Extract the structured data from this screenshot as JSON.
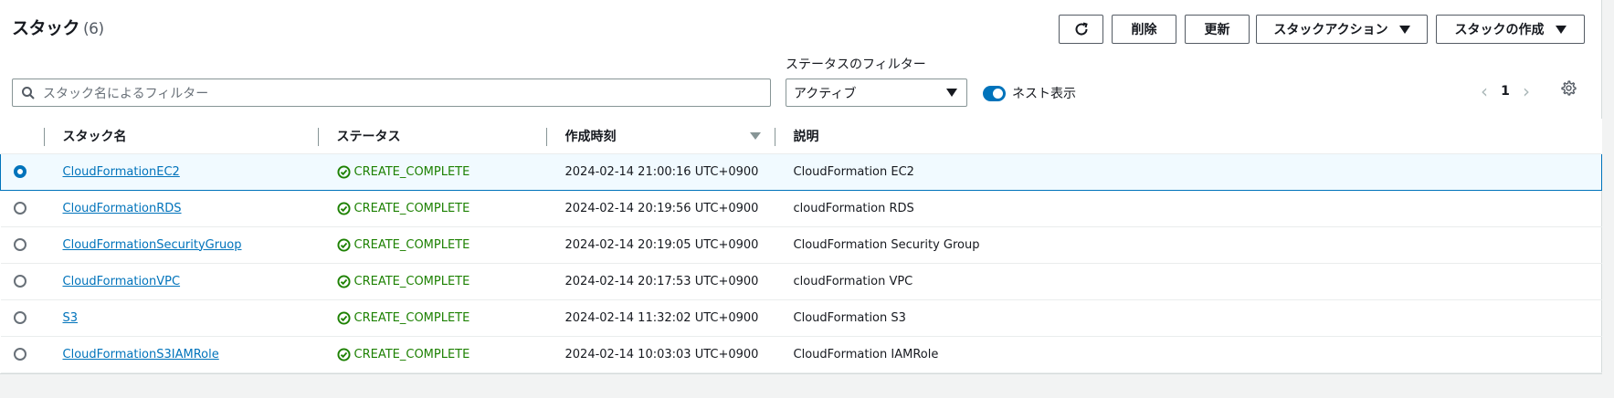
{
  "header": {
    "title": "スタック",
    "count": "(6)"
  },
  "toolbar": {
    "delete_label": "削除",
    "update_label": "更新",
    "stack_actions_label": "スタックアクション",
    "create_stack_label": "スタックの作成"
  },
  "search": {
    "placeholder": "スタック名によるフィルター"
  },
  "status_filter": {
    "label": "ステータスのフィルター",
    "selected": "アクティブ"
  },
  "nested_toggle": {
    "label": "ネスト表示",
    "on": true
  },
  "pagination": {
    "page": "1"
  },
  "table": {
    "columns": [
      "スタック名",
      "ステータス",
      "作成時刻",
      "説明"
    ],
    "rows": [
      {
        "name": "CloudFormationEC2",
        "status": "CREATE_COMPLETE",
        "created": "2024-02-14 21:00:16 UTC+0900",
        "description": "CloudFormation EC2",
        "selected": true
      },
      {
        "name": "CloudFormationRDS",
        "status": "CREATE_COMPLETE",
        "created": "2024-02-14 20:19:56 UTC+0900",
        "description": "cloudFormation RDS",
        "selected": false
      },
      {
        "name": "CloudFormationSecurityGruop",
        "status": "CREATE_COMPLETE",
        "created": "2024-02-14 20:19:05 UTC+0900",
        "description": "CloudFormation Security Group",
        "selected": false
      },
      {
        "name": "CloudFormationVPC",
        "status": "CREATE_COMPLETE",
        "created": "2024-02-14 20:17:53 UTC+0900",
        "description": "cloudFormation VPC",
        "selected": false
      },
      {
        "name": "S3",
        "status": "CREATE_COMPLETE",
        "created": "2024-02-14 11:32:02 UTC+0900",
        "description": "CloudFormation S3",
        "selected": false
      },
      {
        "name": "CloudFormationS3IAMRole",
        "status": "CREATE_COMPLETE",
        "created": "2024-02-14 10:03:03 UTC+0900",
        "description": "CloudFormation IAMRole",
        "selected": false
      }
    ]
  },
  "colors": {
    "link": "#0073bb",
    "success": "#1d8102",
    "toggle": "#0073bb"
  }
}
